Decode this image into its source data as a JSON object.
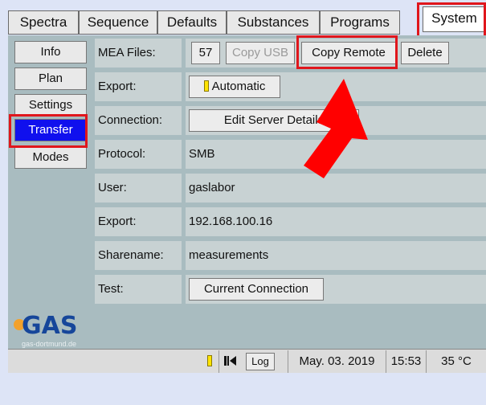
{
  "tabs": [
    {
      "label": "Spectra"
    },
    {
      "label": "Sequence"
    },
    {
      "label": "Defaults"
    },
    {
      "label": "Substances"
    },
    {
      "label": "Programs"
    },
    {
      "label": "System"
    }
  ],
  "sidebar": {
    "items": [
      {
        "label": "Info"
      },
      {
        "label": "Plan"
      },
      {
        "label": "Settings"
      },
      {
        "label": "Transfer"
      },
      {
        "label": "Modes"
      }
    ]
  },
  "rows": {
    "mea_files": {
      "label": "MEA Files:",
      "count": "57",
      "copy_usb": "Copy USB",
      "copy_remote": "Copy Remote",
      "delete": "Delete"
    },
    "export_mode": {
      "label": "Export:",
      "button": "Automatic"
    },
    "connection": {
      "label": "Connection:",
      "button": "Edit Server Details"
    },
    "protocol": {
      "label": "Protocol:",
      "value": "SMB"
    },
    "user": {
      "label": "User:",
      "value": "gaslabor"
    },
    "export_ip": {
      "label": "Export:",
      "value": "192.168.100.16"
    },
    "sharename": {
      "label": "Sharename:",
      "value": "measurements"
    },
    "test": {
      "label": "Test:",
      "button": "Current Connection"
    }
  },
  "logo": {
    "text": "GAS",
    "subtext": "gas-dortmund.de"
  },
  "statusbar": {
    "log_label": "Log",
    "date": "May. 03. 2019",
    "time": "15:53",
    "temperature": "35 °C"
  },
  "colors": {
    "highlight": "#e0161c",
    "active_sidebar": "#1010ee",
    "panel": "#a9bcc0",
    "arrow": "#ff0000"
  },
  "icons": {
    "status_indicator": "yellow-bar-icon",
    "media": "skip-back-icon"
  }
}
